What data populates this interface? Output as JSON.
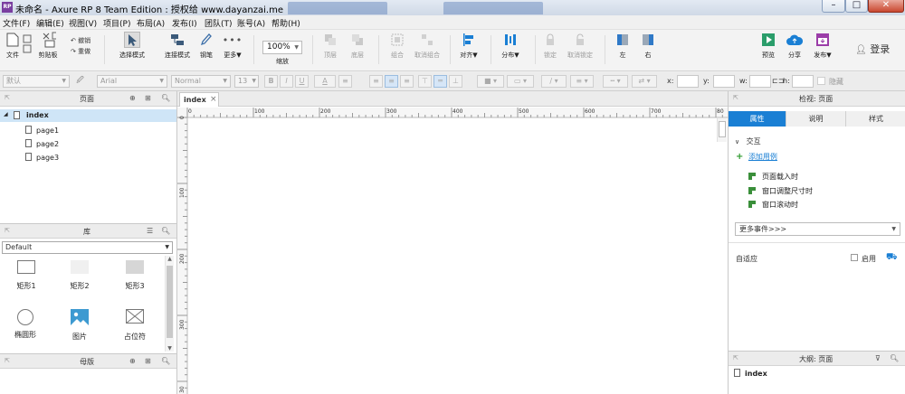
{
  "window": {
    "logo": "RP",
    "title": "未命名 - Axure RP 8 Team Edition : 授权给 www.dayanzai.me",
    "controls": {
      "minimize": "–",
      "maximize": "□",
      "close": "✕"
    }
  },
  "menu": {
    "items": [
      "文件(F)",
      "编辑(E)",
      "视图(V)",
      "项目(P)",
      "布局(A)",
      "发布(I)",
      "团队(T)",
      "账号(A)",
      "帮助(H)"
    ]
  },
  "toolbar": {
    "file": "文件",
    "clipboard": "剪贴板",
    "undo": "撤销",
    "redo": "重做",
    "select_mode": "选择模式",
    "connect_mode": "连接模式",
    "pen": "钢笔",
    "more": "更多▼",
    "zoom_value": "100%",
    "zoom_label": "缩放",
    "top": "顶层",
    "bottom": "底层",
    "group": "组合",
    "ungroup": "取消组合",
    "align": "对齐▼",
    "distribute": "分布▼",
    "lock": "锁定",
    "unlock": "取消锁定",
    "left": "左",
    "right": "右",
    "preview": "预览",
    "share": "分享",
    "publish": "发布▼",
    "login": "登录"
  },
  "format": {
    "style": "默认",
    "font": "Arial",
    "weight": "Normal",
    "size": "13",
    "bold": "B",
    "italic": "I",
    "underline": "U",
    "text_color": "A",
    "x_label": "x:",
    "y_label": "y:",
    "w_label": "w:",
    "h_label": "h:",
    "hidden": "隐藏"
  },
  "pages_panel": {
    "title": "页面",
    "root": "index",
    "children": [
      "page1",
      "page2",
      "page3"
    ]
  },
  "library_panel": {
    "title": "库",
    "selected": "Default",
    "shapes": [
      "矩形1",
      "矩形2",
      "矩形3",
      "椭圆形",
      "图片",
      "占位符"
    ]
  },
  "masters_panel": {
    "title": "母版"
  },
  "canvas": {
    "tab": "index",
    "tab_close": "×",
    "hruler": [
      "0",
      "100",
      "200",
      "300",
      "400",
      "500",
      "600",
      "700",
      "80"
    ],
    "vruler": [
      "0",
      "100",
      "200",
      "300",
      "30"
    ]
  },
  "inspector": {
    "title": "检视: 页面",
    "tabs": [
      "属性",
      "说明",
      "样式"
    ],
    "section": "交互",
    "add_case": "添加用例",
    "events": [
      "页面载入时",
      "窗口调整尺寸时",
      "窗口滚动时"
    ],
    "more_events": "更多事件>>>",
    "adaptive": "自适应",
    "enable": "启用"
  },
  "outline": {
    "title": "大纲: 页面",
    "item": "index"
  },
  "colors": {
    "accent": "#1a7fd4",
    "selected_row": "#cfe5f7",
    "title_bar": "#d6e0ec",
    "add_case_green": "#2e9a2e",
    "logo_purple": "#7a3fa0"
  }
}
